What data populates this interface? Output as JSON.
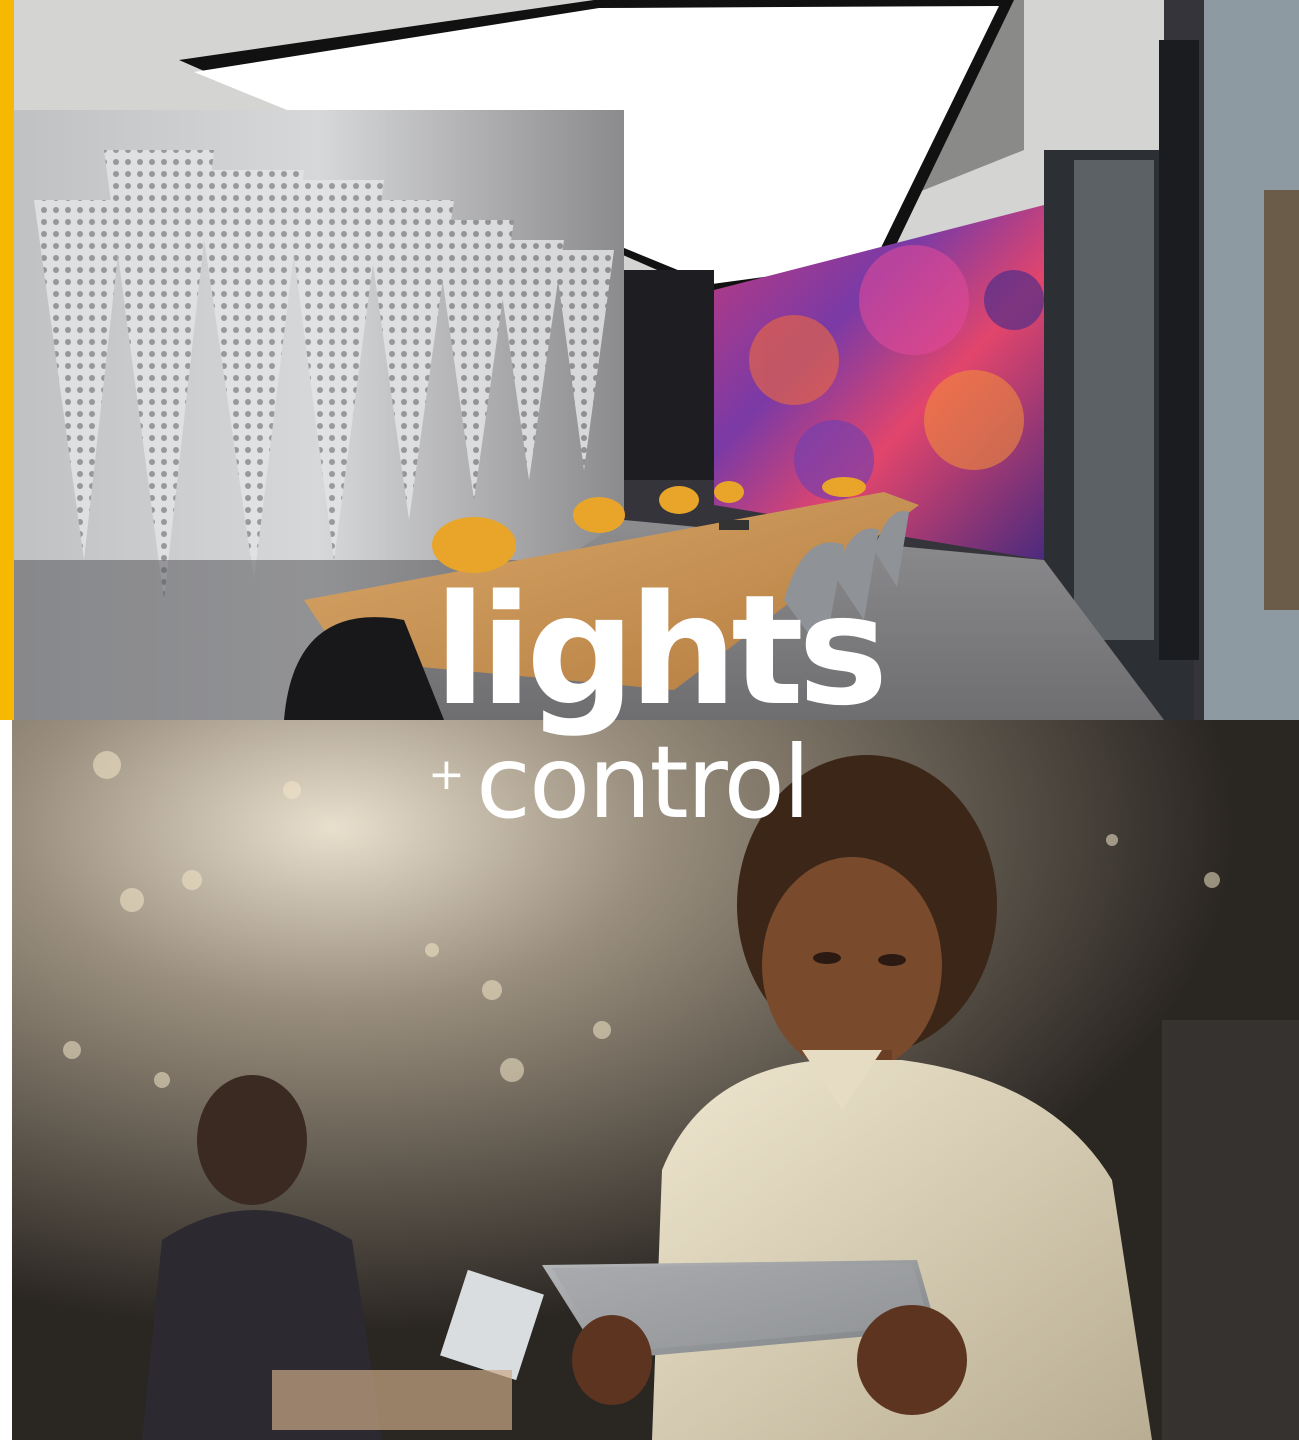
{
  "logo": {
    "word_primary": "lights",
    "plus": "+",
    "word_secondary": "control"
  },
  "colors": {
    "accent": "#f6b800",
    "logo_text": "#ffffff"
  }
}
